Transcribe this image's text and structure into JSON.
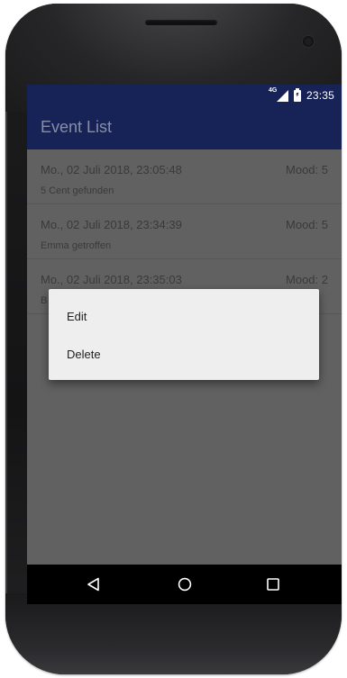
{
  "status_bar": {
    "network_label": "4G",
    "time": "23:35"
  },
  "app_bar": {
    "title": "Event List"
  },
  "events": [
    {
      "date": "Mo., 02 Juli 2018, 23:05:48",
      "mood": "Mood: 5",
      "note": "5 Cent gefunden"
    },
    {
      "date": "Mo., 02 Juli 2018, 23:34:39",
      "mood": "Mood: 5",
      "note": "Emma getroffen"
    },
    {
      "date": "Mo., 02 Juli 2018, 23:35:03",
      "mood": "Mood: 2",
      "note": "B"
    }
  ],
  "context_menu": {
    "edit_label": "Edit",
    "delete_label": "Delete"
  },
  "navigation": {
    "back_icon": "back-triangle-icon",
    "home_icon": "home-circle-icon",
    "recents_icon": "recents-square-icon"
  },
  "colors": {
    "app_bar": "#172356",
    "scrim_background": "#616161",
    "menu_background": "#eeeeee"
  }
}
